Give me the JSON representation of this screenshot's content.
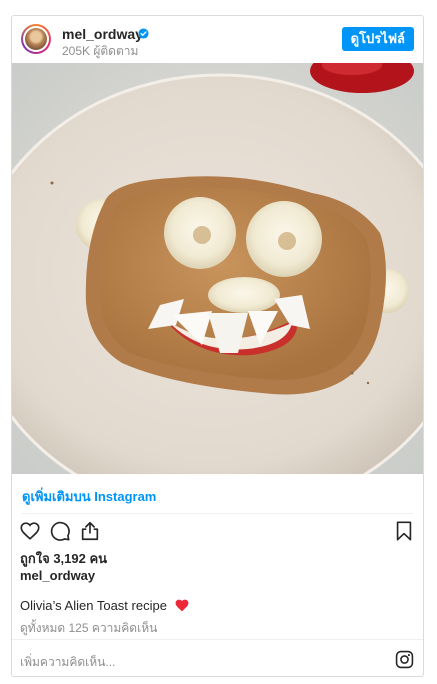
{
  "post": {
    "username": "mel_ordway",
    "followers": "205K ผู้ติดตาม",
    "profile_button": "ดูโปรไฟล์",
    "view_more": "ดูเพิ่มเติมบน Instagram",
    "likes": "ถูกใจ 3,192 คน",
    "owner": "mel_ordway",
    "caption": "Olivia’s Alien Toast recipe",
    "comments": "ดูทั้งหมด 125 ความคิดเห็น",
    "add_comment_placeholder": "เพิ่มความคิดเห็น..."
  },
  "colors": {
    "accent": "#0095f6",
    "heart": "#ed4956"
  },
  "icons": [
    "verified-badge-icon",
    "like-icon",
    "comment-icon",
    "share-icon",
    "bookmark-icon",
    "red-heart-emoji-icon",
    "instagram-logo-icon"
  ]
}
